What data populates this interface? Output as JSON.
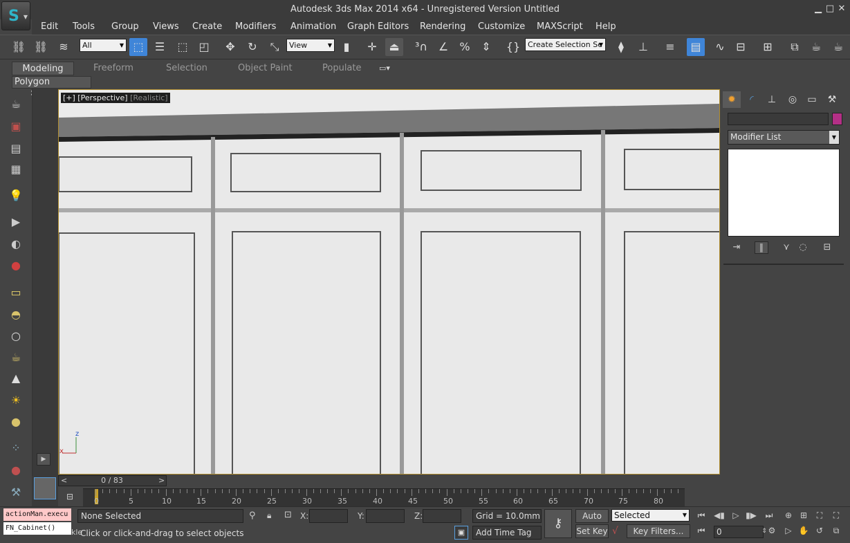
{
  "window": {
    "title": "Autodesk 3ds Max  2014 x64  - Unregistered Version    Untitled",
    "minimize": "▁",
    "maximize": "□",
    "close": "✕"
  },
  "menu": [
    "Edit",
    "Tools",
    "Group",
    "Views",
    "Create",
    "Modifiers",
    "Animation",
    "Graph Editors",
    "Rendering",
    "Customize",
    "MAXScript",
    "Help"
  ],
  "toolbar": {
    "filter_value": "All",
    "refcoord_value": "View",
    "named_selection_value": "Create Selection Se"
  },
  "ribbon": {
    "tabs": [
      "Modeling",
      "Freeform",
      "Selection",
      "Object Paint",
      "Populate"
    ],
    "panel_label": "Polygon Modeling"
  },
  "viewport": {
    "label_main": "[+] [Perspective]",
    "label_mode": "[Realistic]",
    "axis_x": "x",
    "axis_z": "z"
  },
  "command_panel": {
    "modifier_list": "Modifier List",
    "accent_color": "#b42f86"
  },
  "timeline": {
    "time_slider": "0 / 83",
    "prev": "<",
    "next": ">",
    "ticks": [
      "0",
      "5",
      "10",
      "15",
      "20",
      "25",
      "30",
      "35",
      "40",
      "45",
      "50",
      "55",
      "60",
      "65",
      "70",
      "75",
      "80"
    ]
  },
  "status": {
    "listener_line1": "actionMan.execu",
    "listener_line2": "FN_Cabinet()",
    "listener_side": "kle",
    "selection": "None Selected",
    "prompt": "Click or click-and-drag to select objects",
    "x_label": "X:",
    "y_label": "Y:",
    "z_label": "Z:",
    "grid": "Grid = 10.0mm",
    "add_time_tag": "Add Time Tag",
    "auto_key": "Auto Key",
    "set_key": "Set Key",
    "selected_value": "Selected",
    "key_filters": "Key Filters...",
    "current_frame": "0"
  }
}
